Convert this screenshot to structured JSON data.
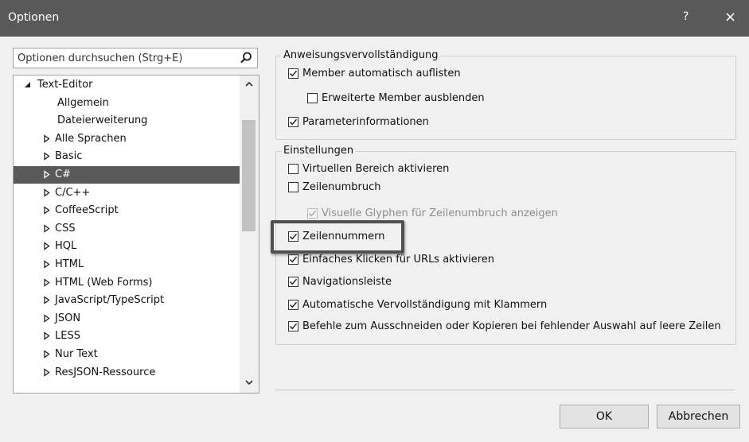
{
  "window": {
    "title": "Optionen",
    "help": "?",
    "close": "×"
  },
  "search": {
    "placeholder": "Optionen durchsuchen (Strg+E)"
  },
  "tree": {
    "items": [
      {
        "label": "Text-Editor",
        "expanded": true,
        "level": 0
      },
      {
        "label": "Allgemein",
        "level": 1
      },
      {
        "label": "Dateierweiterung",
        "level": 1
      },
      {
        "label": "Alle Sprachen",
        "level": 1
      },
      {
        "label": "Basic",
        "level": 1
      },
      {
        "label": "C#",
        "level": 1,
        "selected": true
      },
      {
        "label": "C/C++",
        "level": 1
      },
      {
        "label": "CoffeeScript",
        "level": 1
      },
      {
        "label": "CSS",
        "level": 1
      },
      {
        "label": "HQL",
        "level": 1
      },
      {
        "label": "HTML",
        "level": 1
      },
      {
        "label": "HTML (Web Forms)",
        "level": 1
      },
      {
        "label": "JavaScript/TypeScript",
        "level": 1
      },
      {
        "label": "JSON",
        "level": 1
      },
      {
        "label": "LESS",
        "level": 1
      },
      {
        "label": "Nur Text",
        "level": 1
      },
      {
        "label": "ResJSON-Ressource",
        "level": 1
      }
    ]
  },
  "groups": {
    "completion": {
      "label": "Anweisungsvervollständigung",
      "options": [
        {
          "label": "Member automatisch auflisten",
          "checked": true
        },
        {
          "label": "Erweiterte Member ausblenden",
          "checked": false
        },
        {
          "label": "Parameterinformationen",
          "checked": true
        }
      ]
    },
    "settings": {
      "label": "Einstellungen",
      "options": [
        {
          "label": "Virtuellen Bereich aktivieren",
          "checked": false
        },
        {
          "label": "Zeilenumbruch",
          "checked": false
        },
        {
          "label": "Visuelle Glyphen für Zeilenumbruch anzeigen",
          "checked": true,
          "disabled": true
        },
        {
          "label": "Zeilennummern",
          "checked": true,
          "highlighted": true
        },
        {
          "label": "Einfaches Klicken für URLs aktivieren",
          "checked": true
        },
        {
          "label": "Navigationsleiste",
          "checked": true
        },
        {
          "label": "Automatische Vervollständigung mit Klammern",
          "checked": true
        },
        {
          "label": "Befehle zum Ausschneiden oder Kopieren bei fehlender Auswahl auf leere Zeilen",
          "checked": true
        }
      ]
    }
  },
  "buttons": {
    "ok": "OK",
    "cancel": "Abbrechen"
  },
  "colors": {
    "titlebar": "#595959",
    "selection": "#595959",
    "dialog_bg": "#f0f0f0"
  }
}
